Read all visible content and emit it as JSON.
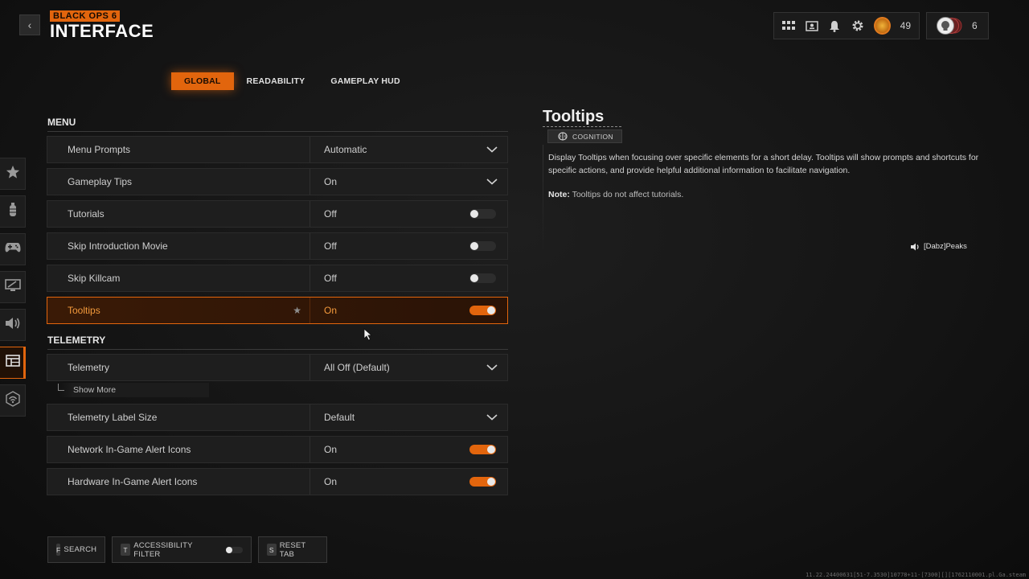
{
  "header": {
    "back_label": "‹",
    "logo_top": "BLACK OPS 6",
    "title": "INTERFACE",
    "player_level": "49",
    "prestige_count": "6"
  },
  "tabs": [
    {
      "label": "GLOBAL",
      "active": true
    },
    {
      "label": "READABILITY",
      "active": false
    },
    {
      "label": "GAMEPLAY HUD",
      "active": false
    }
  ],
  "sections": {
    "menu": "MENU",
    "telemetry": "TELEMETRY"
  },
  "settings": {
    "menu_prompts": {
      "label": "Menu Prompts",
      "value": "Automatic"
    },
    "gameplay_tips": {
      "label": "Gameplay Tips",
      "value": "On"
    },
    "tutorials": {
      "label": "Tutorials",
      "value": "Off"
    },
    "skip_intro": {
      "label": "Skip Introduction Movie",
      "value": "Off"
    },
    "skip_killcam": {
      "label": "Skip Killcam",
      "value": "Off"
    },
    "tooltips": {
      "label": "Tooltips",
      "value": "On"
    },
    "telemetry": {
      "label": "Telemetry",
      "value": "All Off (Default)"
    },
    "show_more": "Show More",
    "telemetry_label_size": {
      "label": "Telemetry Label Size",
      "value": "Default"
    },
    "network_alert": {
      "label": "Network In-Game Alert Icons",
      "value": "On"
    },
    "hardware_alert": {
      "label": "Hardware In-Game Alert Icons",
      "value": "On"
    }
  },
  "bottom": {
    "search_key": "F",
    "search_label": "SEARCH",
    "filter_key": "T",
    "filter_label": "ACCESSIBILITY FILTER",
    "reset_key": "S",
    "reset_label": "RESET TAB"
  },
  "info": {
    "title": "Tooltips",
    "tag": "COGNITION",
    "description": "Display Tooltips when focusing over specific elements for a short delay. Tooltips will show prompts and shortcuts for specific actions, and provide helpful additional information to facilitate navigation.",
    "note_label": "Note:",
    "note_text": " Tooltips do not affect tutorials."
  },
  "voice_chat_user": "[Dabz]Peaks",
  "build_string": "11.22.24400631[51-7.3530]10778+11-[7300][][1762110001.pl.Ga.steam",
  "colors": {
    "accent": "#e2650d",
    "focused_text": "#f39a3c",
    "row_bg": "#1e1e1e"
  }
}
